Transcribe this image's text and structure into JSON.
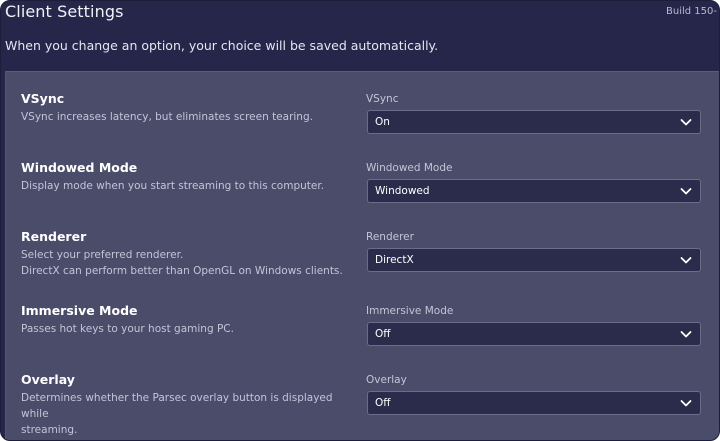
{
  "window": {
    "title": "Client Settings",
    "build": "Build 150-",
    "subtitle": "When you change an option, your choice will be saved automatically."
  },
  "settings": [
    {
      "title": "VSync",
      "description": "VSync increases latency, but eliminates screen tearing.",
      "field_label": "VSync",
      "value": "On"
    },
    {
      "title": "Windowed Mode",
      "description": "Display mode when you start streaming to this computer.",
      "field_label": "Windowed Mode",
      "value": "Windowed"
    },
    {
      "title": "Renderer",
      "description": "Select your preferred renderer.\nDirectX can perform better than OpenGL on Windows clients.",
      "field_label": "Renderer",
      "value": "DirectX"
    },
    {
      "title": "Immersive Mode",
      "description": "Passes hot keys to your host gaming PC.",
      "field_label": "Immersive Mode",
      "value": "Off"
    },
    {
      "title": "Overlay",
      "description": "Determines whether the Parsec overlay button is displayed while\nstreaming.",
      "field_label": "Overlay",
      "value": "Off"
    }
  ],
  "icons": {
    "dropdown": "chevron-down-icon"
  },
  "colors": {
    "header_bg": "#25264a",
    "panel_bg": "#4a4c6a",
    "select_bg": "#2b2c4b"
  }
}
